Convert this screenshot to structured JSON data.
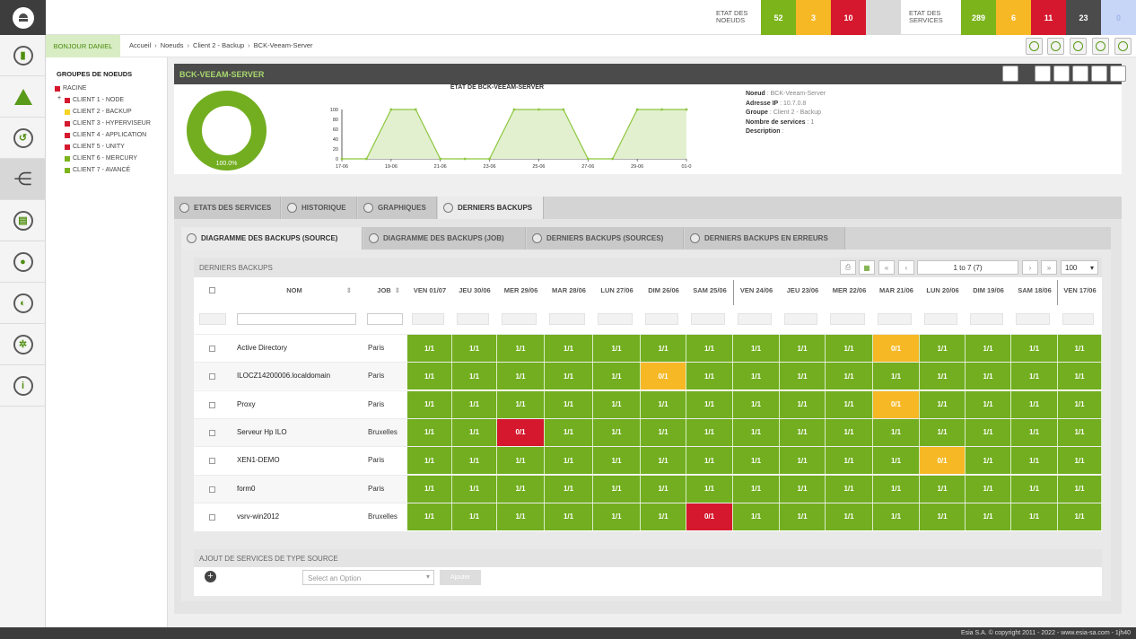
{
  "top": {
    "noeuds_label": "ETAT DES NOEUDS",
    "noeuds": [
      {
        "value": "52",
        "color": "#7cb41c"
      },
      {
        "value": "3",
        "color": "#f6b825"
      },
      {
        "value": "10",
        "color": "#d5182d"
      },
      {
        "value": "",
        "color": "#d9d9d9"
      }
    ],
    "services_label": "ETAT DES SERVICES",
    "services": [
      {
        "value": "289",
        "color": "#7cb41c"
      },
      {
        "value": "6",
        "color": "#f6b825"
      },
      {
        "value": "11",
        "color": "#d5182d"
      },
      {
        "value": "23",
        "color": "#4b4b4b"
      },
      {
        "value": "0",
        "color": "#c7d6f7"
      }
    ]
  },
  "breadcrumb": {
    "hello": "BONJOUR DANIEL",
    "items": [
      "Accueil",
      "Noeuds",
      "Client 2 - Backup",
      "BCK-Veeam-Server"
    ]
  },
  "tree": {
    "title": "GROUPES DE NOEUDS",
    "root": {
      "label": "RACINE",
      "color": "#d5182d"
    },
    "items": [
      {
        "label": "CLIENT 1 - NODE",
        "color": "#d5182d"
      },
      {
        "label": "CLIENT 2 - BACKUP",
        "color": "#f6d325"
      },
      {
        "label": "CLIENT 3 - HYPERVISEUR",
        "color": "#d5182d"
      },
      {
        "label": "CLIENT 4 - APPLICATION",
        "color": "#d5182d"
      },
      {
        "label": "CLIENT 5 - UNITY",
        "color": "#d5182d"
      },
      {
        "label": "CLIENT 6 - MERCURY",
        "color": "#7cb41c"
      },
      {
        "label": "CLIENT 7 - AVANCÉ",
        "color": "#7cb41c"
      }
    ]
  },
  "node": {
    "title": "BCK-VEEAM-SERVER",
    "donut_label": "100.0%",
    "donut_fraction": 1.0,
    "info": [
      {
        "key": "Noeud",
        "value": "BCK-Veeam-Server"
      },
      {
        "key": "Adresse IP",
        "value": "10.7.0.8"
      },
      {
        "key": "Groupe",
        "value": "Client 2 - Backup"
      },
      {
        "key": "Nombre de services",
        "value": "1"
      },
      {
        "key": "Description",
        "value": ""
      }
    ]
  },
  "chart_data": {
    "type": "area",
    "title": "ÉTAT DE BCK-VEEAM-SERVER",
    "x": [
      "17-06",
      "18-06",
      "19-06",
      "20-06",
      "21-06",
      "22-06",
      "23-06",
      "24-06",
      "25-06",
      "26-06",
      "27-06",
      "28-06",
      "29-06",
      "30-06",
      "01-07"
    ],
    "xticks": [
      "17-06",
      "19-06",
      "21-06",
      "23-06",
      "25-06",
      "27-06",
      "29-06",
      "01-0"
    ],
    "values": [
      0,
      0,
      100,
      100,
      0,
      0,
      0,
      100,
      100,
      100,
      0,
      0,
      100,
      100,
      100
    ],
    "ylim": [
      0,
      100
    ],
    "yticks": [
      0,
      20,
      40,
      60,
      80,
      100
    ]
  },
  "tabs": [
    "ETATS DES SERVICES",
    "HISTORIQUE",
    "GRAPHIQUES",
    "DERNIERS BACKUPS"
  ],
  "subtabs": [
    "DIAGRAMME DES BACKUPS (SOURCE)",
    "DIAGRAMME DES BACKUPS (JOB)",
    "DERNIERS BACKUPS (SOURCES)",
    "DERNIERS BACKUPS EN ERREURS"
  ],
  "grid": {
    "title": "DERNIERS BACKUPS",
    "page": "1 to 7 (7)",
    "page_size": "100",
    "col_nom": "NOM",
    "col_job": "JOB",
    "days": [
      "VEN 01/07",
      "JEU 30/06",
      "MER 29/06",
      "MAR 28/06",
      "LUN 27/06",
      "DIM 26/06",
      "SAM 25/06",
      "VEN 24/06",
      "JEU 23/06",
      "MER 22/06",
      "MAR 21/06",
      "LUN 20/06",
      "DIM 19/06",
      "SAM 18/06",
      "VEN 17/06"
    ],
    "rows": [
      {
        "name": "Active Directory",
        "job": "Paris",
        "cells": [
          "1/1",
          "1/1",
          "1/1",
          "1/1",
          "1/1",
          "1/1",
          "1/1",
          "1/1",
          "1/1",
          "1/1",
          "0/1",
          "1/1",
          "1/1",
          "1/1",
          "1/1"
        ]
      },
      {
        "name": "ILOCZ14200006.localdomain",
        "job": "Paris",
        "cells": [
          "1/1",
          "1/1",
          "1/1",
          "1/1",
          "1/1",
          "0/1",
          "1/1",
          "1/1",
          "1/1",
          "1/1",
          "1/1",
          "1/1",
          "1/1",
          "1/1",
          "1/1"
        ]
      },
      {
        "name": "Proxy",
        "job": "Paris",
        "cells": [
          "1/1",
          "1/1",
          "1/1",
          "1/1",
          "1/1",
          "1/1",
          "1/1",
          "1/1",
          "1/1",
          "1/1",
          "0/1",
          "1/1",
          "1/1",
          "1/1",
          "1/1"
        ]
      },
      {
        "name": "Serveur Hp ILO",
        "job": "Bruxelles",
        "cells": [
          "1/1",
          "1/1",
          "0/1",
          "1/1",
          "1/1",
          "1/1",
          "1/1",
          "1/1",
          "1/1",
          "1/1",
          "1/1",
          "1/1",
          "1/1",
          "1/1",
          "1/1"
        ]
      },
      {
        "name": "XEN1-DEMO",
        "job": "Paris",
        "cells": [
          "1/1",
          "1/1",
          "1/1",
          "1/1",
          "1/1",
          "1/1",
          "1/1",
          "1/1",
          "1/1",
          "1/1",
          "1/1",
          "0/1",
          "1/1",
          "1/1",
          "1/1"
        ]
      },
      {
        "name": "form0",
        "job": "Paris",
        "cells": [
          "1/1",
          "1/1",
          "1/1",
          "1/1",
          "1/1",
          "1/1",
          "1/1",
          "1/1",
          "1/1",
          "1/1",
          "1/1",
          "1/1",
          "1/1",
          "1/1",
          "1/1"
        ]
      },
      {
        "name": "vsrv-win2012",
        "job": "Bruxelles",
        "cells": [
          "1/1",
          "1/1",
          "1/1",
          "1/1",
          "1/1",
          "1/1",
          "0/1",
          "1/1",
          "1/1",
          "1/1",
          "1/1",
          "1/1",
          "1/1",
          "1/1",
          "1/1"
        ]
      }
    ],
    "status": [
      [
        "ok",
        "ok",
        "ok",
        "ok",
        "ok",
        "ok",
        "ok",
        "ok",
        "ok",
        "ok",
        "warn",
        "ok",
        "ok",
        "ok",
        "ok"
      ],
      [
        "ok",
        "ok",
        "ok",
        "ok",
        "ok",
        "warn",
        "ok",
        "ok",
        "ok",
        "ok",
        "ok",
        "ok",
        "ok",
        "ok",
        "ok"
      ],
      [
        "ok",
        "ok",
        "ok",
        "ok",
        "ok",
        "ok",
        "ok",
        "ok",
        "ok",
        "ok",
        "warn",
        "ok",
        "ok",
        "ok",
        "ok"
      ],
      [
        "ok",
        "ok",
        "err",
        "ok",
        "ok",
        "ok",
        "ok",
        "ok",
        "ok",
        "ok",
        "ok",
        "ok",
        "ok",
        "ok",
        "ok"
      ],
      [
        "ok",
        "ok",
        "ok",
        "ok",
        "ok",
        "ok",
        "ok",
        "ok",
        "ok",
        "ok",
        "ok",
        "warn",
        "ok",
        "ok",
        "ok"
      ],
      [
        "ok",
        "ok",
        "ok",
        "ok",
        "ok",
        "ok",
        "ok",
        "ok",
        "ok",
        "ok",
        "ok",
        "ok",
        "ok",
        "ok",
        "ok"
      ],
      [
        "ok",
        "ok",
        "ok",
        "ok",
        "ok",
        "ok",
        "err",
        "ok",
        "ok",
        "ok",
        "ok",
        "ok",
        "ok",
        "ok",
        "ok"
      ]
    ]
  },
  "add": {
    "title": "AJOUT DE SERVICES DE TYPE SOURCE",
    "placeholder": "Select an Option",
    "button": "Ajouter"
  },
  "footer": "Esia S.A. © copyright 2011 - 2022 - www.esia-sa.com - 1jh40"
}
